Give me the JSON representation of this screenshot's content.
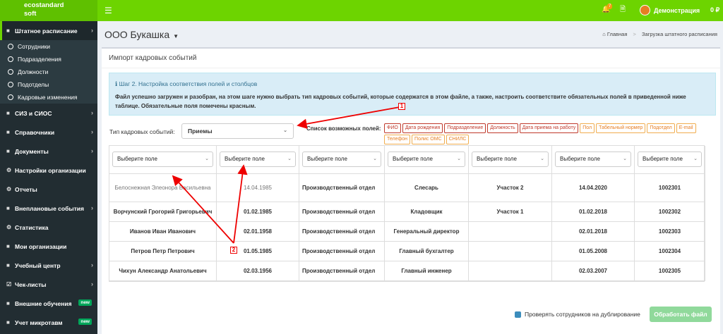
{
  "topbar": {
    "logo": "ecostandard\nsoft",
    "menu_icon": "hamburger-icon",
    "bell_count": "7",
    "user_name": "Демонстрация",
    "balance": "0 ₽"
  },
  "sidebar": {
    "items": [
      {
        "label": "Штатное расписание",
        "icon": "users-icon",
        "active": true
      },
      {
        "label": "СИЗ и СИОС"
      },
      {
        "label": "Справочники"
      },
      {
        "label": "Документы"
      },
      {
        "label": "Настройки организации"
      },
      {
        "label": "Отчеты"
      },
      {
        "label": "Внеплановые события"
      },
      {
        "label": "Статистика"
      },
      {
        "label": "Мои организации"
      },
      {
        "label": "Учебный центр"
      },
      {
        "label": "Чек-листы"
      },
      {
        "label": "Внешние обучения",
        "badge": "new"
      },
      {
        "label": "Учет микротавм",
        "badge": "new"
      }
    ],
    "subitems": [
      "Сотрудники",
      "Подразделения",
      "Должности",
      "Подотделы",
      "Кадровые изменения"
    ]
  },
  "page": {
    "title": "ООО Букашка",
    "breadcrumb_home": "Главная",
    "breadcrumb_current": "Загрузка штатного расписания"
  },
  "box": {
    "title": "Импорт кадровых событий",
    "info_heading": "Шаг 2. Настройка соответствия полей и столбцов",
    "info_text": "Файл успешно загружен и разобран, на этом шаге нужно выбрать тип кадровых событий, которые содержатся в этом файле, а также, настроить соответствите обязательных полей в приведенной ниже таблице. Обязательные поля помечены красным.",
    "type_label": "Тип кадровых событий:",
    "type_value": "Приемы",
    "fields_label": "Список возможных полей:",
    "fields_required": [
      "ФИО",
      "Дата рождения",
      "Подразделение",
      "Должность",
      "Дата приема на работу"
    ],
    "fields_optional": [
      "Пол",
      "Табельный нормер",
      "Подотдел",
      "E-mail",
      "Телефон",
      "Полис ОМС",
      "СНИЛС"
    ],
    "column_placeholder": "Выберите поле",
    "rows": [
      [
        "Белоснежная Элеонора Васильевна",
        "14.04.1985",
        "Производственный отдел",
        "Слесарь",
        "Участок 2",
        "14.04.2020",
        "1002301"
      ],
      [
        "Ворчунский Грогорий Григорьевич",
        "01.02.1985",
        "Производственный отдел",
        "Кладовщик",
        "Участок 1",
        "01.02.2018",
        "1002302"
      ],
      [
        "Иванов Иван Иванович",
        "02.01.1958",
        "Производственный отдел",
        "Генеральный директор",
        "",
        "02.01.2018",
        "1002303"
      ],
      [
        "Петров Петр Петрович",
        "01.05.1985",
        "Производственный отдел",
        "Главный бухгалтер",
        "",
        "01.05.2008",
        "1002304"
      ],
      [
        "Чихун Александр Анатольевич",
        "02.03.1956",
        "Производственный отдел",
        "Главный инженер",
        "",
        "02.03.2007",
        "1002305"
      ]
    ],
    "check_duplicates_label": "Проверять сотрудников на дублирование",
    "process_button": "Обработать файл"
  },
  "annotations": {
    "label1": "1",
    "label2": "2",
    "color": "#ee0000"
  }
}
